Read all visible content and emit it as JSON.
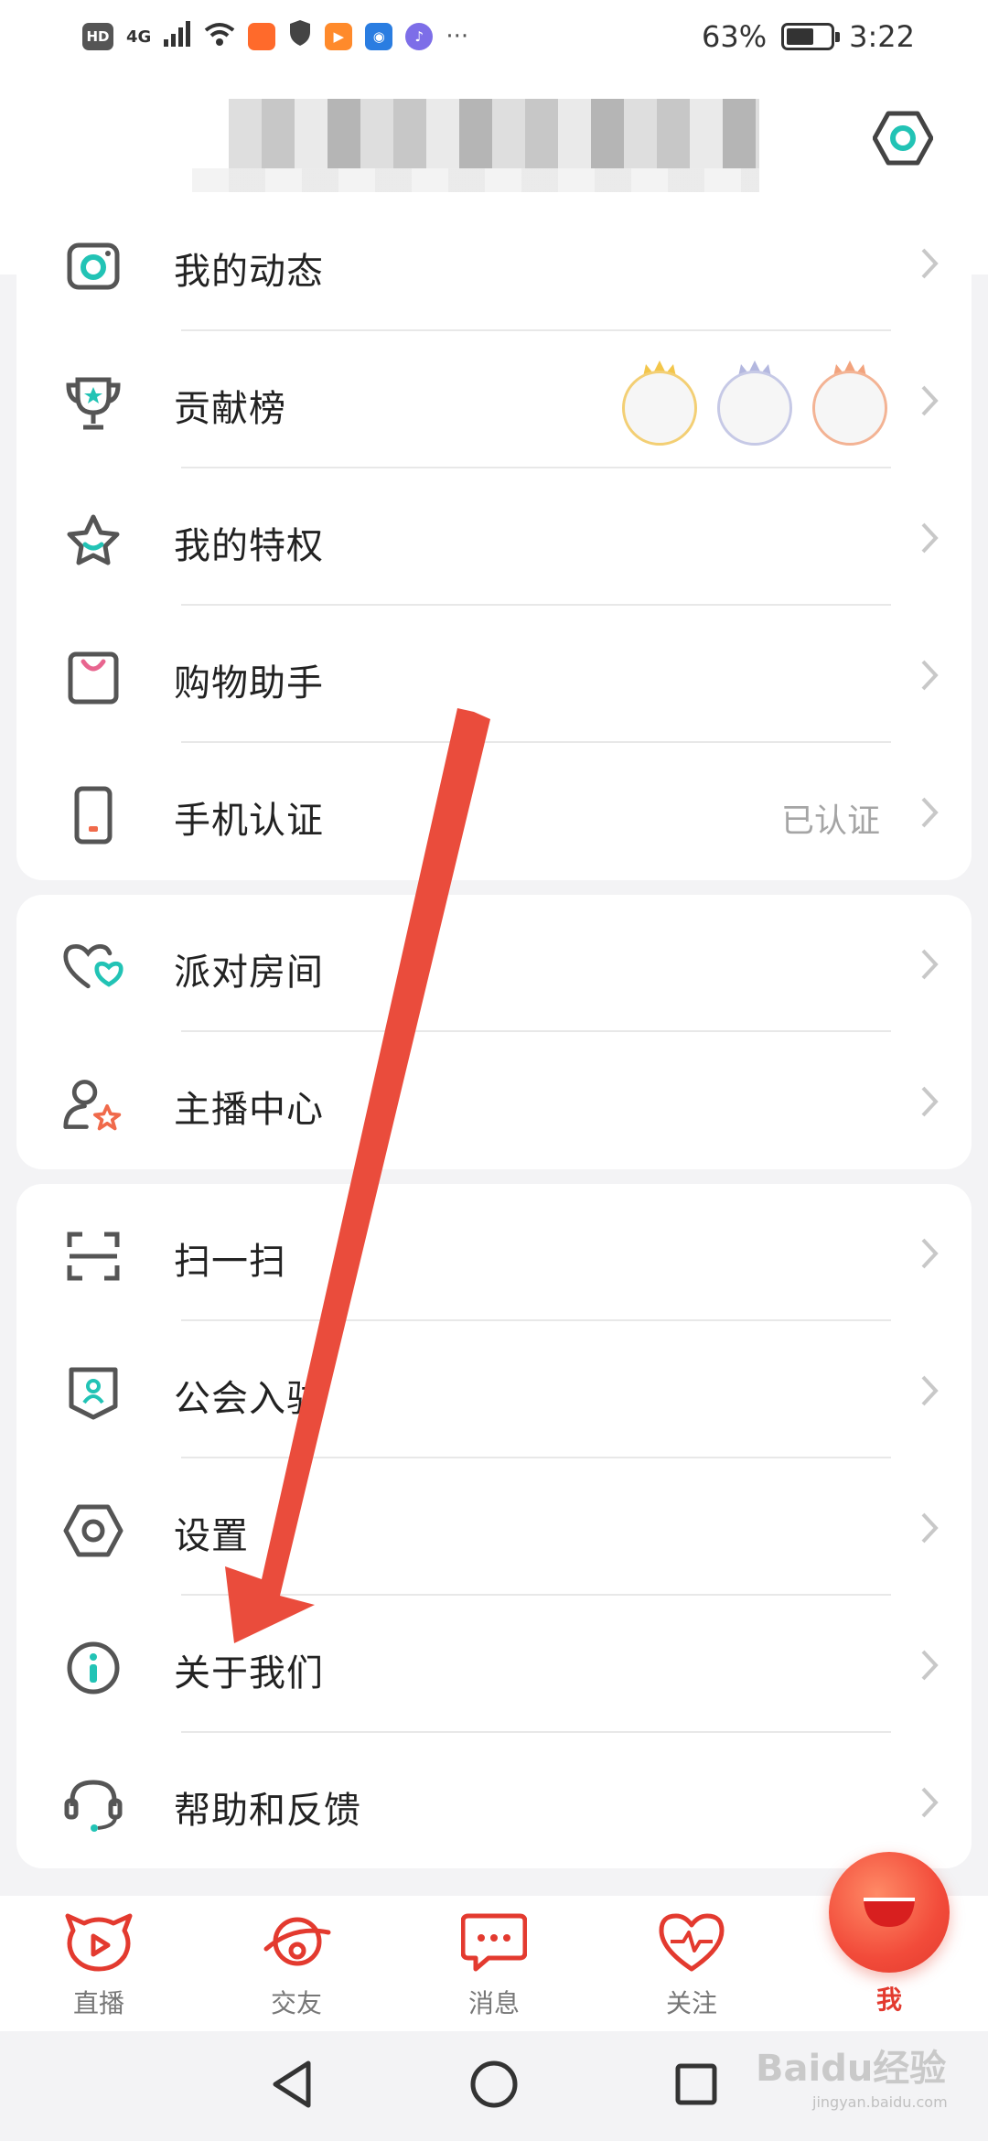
{
  "status_bar": {
    "left_text": "HD",
    "network": "4G",
    "battery": "63%",
    "time": "3:22"
  },
  "header": {
    "settings_icon": "settings-icon"
  },
  "group1": [
    {
      "label": "我的动态",
      "icon": "camera-icon"
    },
    {
      "label": "贡献榜",
      "icon": "trophy-icon"
    },
    {
      "label": "我的特权",
      "icon": "star-icon"
    },
    {
      "label": "购物助手",
      "icon": "shopping-bag-icon"
    },
    {
      "label": "手机认证",
      "icon": "phone-icon",
      "value": "已认证"
    }
  ],
  "group2": [
    {
      "label": "派对房间",
      "icon": "party-heart-icon"
    },
    {
      "label": "主播中心",
      "icon": "anchor-star-icon"
    }
  ],
  "group3": [
    {
      "label": "扫一扫",
      "icon": "scan-icon"
    },
    {
      "label": "公会入驻",
      "icon": "guild-icon"
    },
    {
      "label": "设置",
      "icon": "settings-hex-icon"
    },
    {
      "label": "关于我们",
      "icon": "info-icon"
    },
    {
      "label": "帮助和反馈",
      "icon": "headset-icon"
    }
  ],
  "bottom_nav": [
    {
      "label": "直播",
      "icon": "live-icon"
    },
    {
      "label": "交友",
      "icon": "friends-icon"
    },
    {
      "label": "消息",
      "icon": "message-icon"
    },
    {
      "label": "关注",
      "icon": "heart-pulse-icon"
    },
    {
      "label": "我",
      "icon": "me-icon"
    }
  ],
  "watermark": {
    "brand": "Baidu经验",
    "url": "jingyan.baidu.com"
  },
  "colors": {
    "teal": "#22c3b5",
    "red": "#e33a2f",
    "arrow": "#ea4c3c"
  }
}
